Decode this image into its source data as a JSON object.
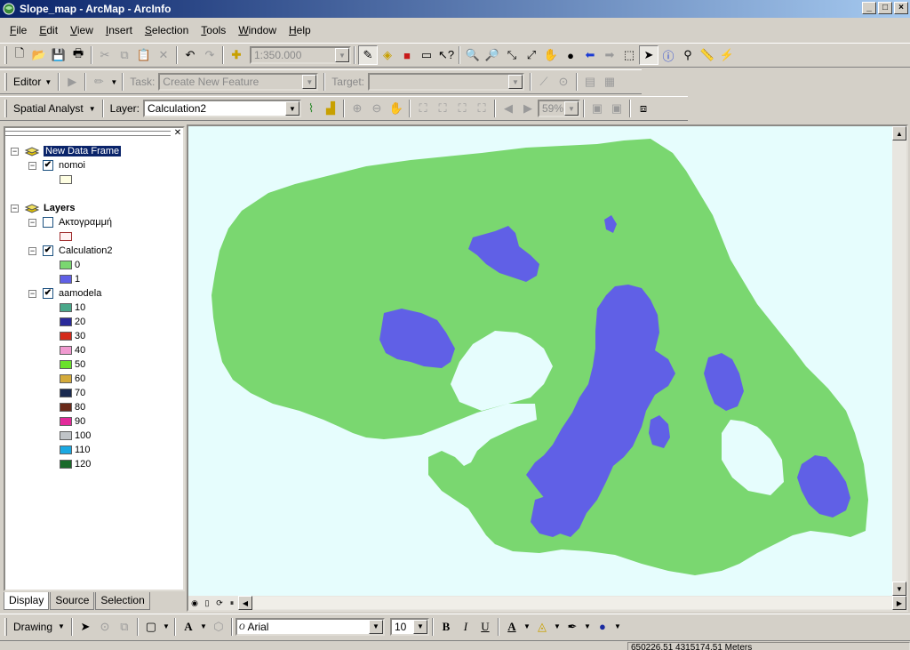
{
  "window": {
    "title": "Slope_map - ArcMap - ArcInfo",
    "minimize": "_",
    "maximize": "□",
    "close": "×"
  },
  "menu": [
    {
      "pre": "",
      "u": "F",
      "post": "ile"
    },
    {
      "pre": "",
      "u": "E",
      "post": "dit"
    },
    {
      "pre": "",
      "u": "V",
      "post": "iew"
    },
    {
      "pre": "",
      "u": "I",
      "post": "nsert"
    },
    {
      "pre": "",
      "u": "S",
      "post": "election"
    },
    {
      "pre": "",
      "u": "T",
      "post": "ools"
    },
    {
      "pre": "",
      "u": "W",
      "post": "indow"
    },
    {
      "pre": "",
      "u": "H",
      "post": "elp"
    }
  ],
  "standard": {
    "scale": "1:350.000"
  },
  "editor": {
    "label": "Editor",
    "task_label": "Task:",
    "task_value": "Create New Feature",
    "target_label": "Target:",
    "target_value": ""
  },
  "spatial": {
    "label": "Spatial Analyst",
    "layer_label": "Layer:",
    "layer_value": "Calculation2",
    "zoom": "59%"
  },
  "toc": {
    "frame1": "New Data Frame",
    "nomoi": "nomoi",
    "layers": "Layers",
    "akto": "Ακτογραμμή",
    "calc": "Calculation2",
    "calc_classes": [
      {
        "label": "0",
        "color": "#7ad770"
      },
      {
        "label": "1",
        "color": "#6060e6"
      }
    ],
    "aamodela": "aamodela",
    "aam_classes": [
      {
        "label": "10",
        "color": "#4aa88a"
      },
      {
        "label": "20",
        "color": "#2a2a9a"
      },
      {
        "label": "30",
        "color": "#d42a1a"
      },
      {
        "label": "40",
        "color": "#f09ad0"
      },
      {
        "label": "50",
        "color": "#6ae22a"
      },
      {
        "label": "60",
        "color": "#d4aa3a"
      },
      {
        "label": "70",
        "color": "#1a2a50"
      },
      {
        "label": "80",
        "color": "#6a2a1a"
      },
      {
        "label": "90",
        "color": "#e22a9a"
      },
      {
        "label": "100",
        "color": "#c0c4c8"
      },
      {
        "label": "110",
        "color": "#1aa8e2"
      },
      {
        "label": "120",
        "color": "#1a6a2a"
      }
    ],
    "nomoi_color": "#fefee2",
    "akto_color": "#fff2f2"
  },
  "tabs": [
    "Display",
    "Source",
    "Selection"
  ],
  "drawing": {
    "label": "Drawing",
    "font": "Arial",
    "size": "10",
    "bold": "B",
    "italic": "I",
    "underline": "U",
    "fontcolor": "A"
  },
  "status": {
    "coords": "650226,51  4315174,51 Meters"
  },
  "colors": {
    "land": "#7ad770",
    "slope": "#6060e6",
    "sea": "#e6fdfd"
  }
}
